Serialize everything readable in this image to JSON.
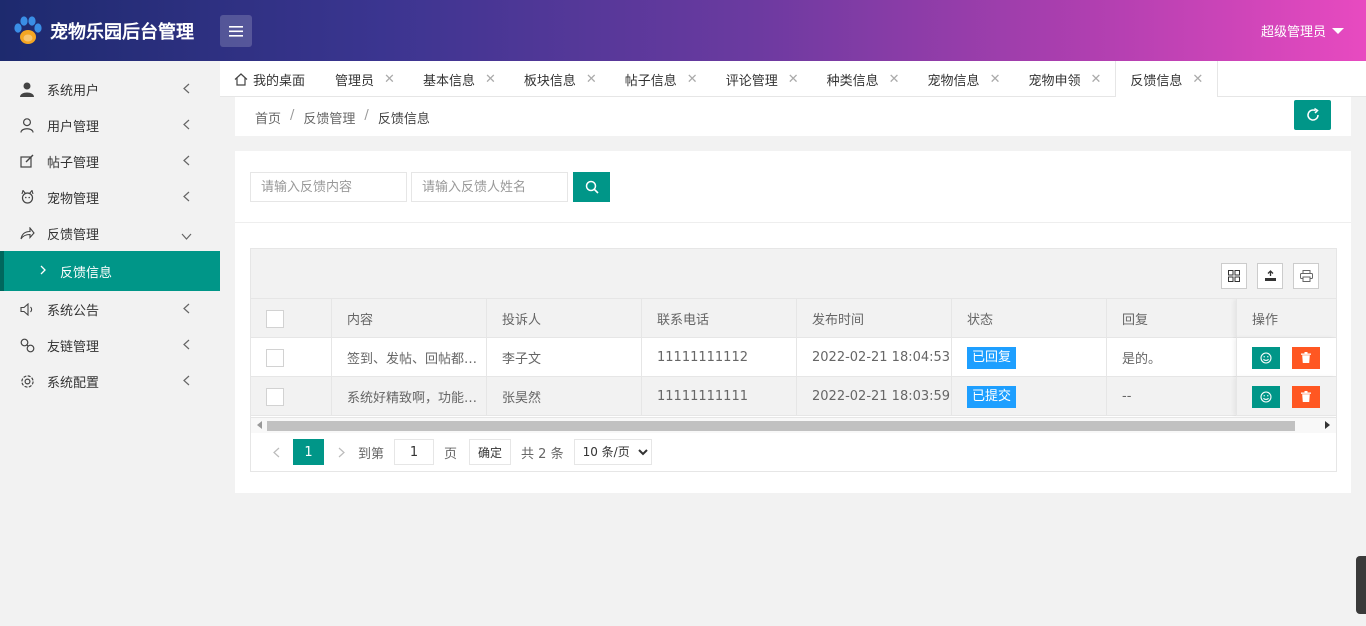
{
  "app": {
    "title": "宠物乐园后台管理",
    "user": "超级管理员"
  },
  "sidebar": {
    "items": [
      {
        "label": "系统用户",
        "icon": "user-solid-icon"
      },
      {
        "label": "用户管理",
        "icon": "user-icon"
      },
      {
        "label": "帖子管理",
        "icon": "edit-icon"
      },
      {
        "label": "宠物管理",
        "icon": "pet-icon"
      },
      {
        "label": "反馈管理",
        "icon": "share-icon",
        "expanded": true
      },
      {
        "label": "系统公告",
        "icon": "speaker-icon"
      },
      {
        "label": "友链管理",
        "icon": "link-icon"
      },
      {
        "label": "系统配置",
        "icon": "gear-icon"
      }
    ],
    "active_sub": "反馈信息"
  },
  "tabs": [
    {
      "label": "我的桌面",
      "closable": false
    },
    {
      "label": "管理员",
      "closable": true
    },
    {
      "label": "基本信息",
      "closable": true
    },
    {
      "label": "板块信息",
      "closable": true
    },
    {
      "label": "帖子信息",
      "closable": true
    },
    {
      "label": "评论管理",
      "closable": true
    },
    {
      "label": "种类信息",
      "closable": true
    },
    {
      "label": "宠物信息",
      "closable": true
    },
    {
      "label": "宠物申领",
      "closable": true
    },
    {
      "label": "反馈信息",
      "closable": true,
      "active": true
    }
  ],
  "breadcrumb": [
    "首页",
    "反馈管理",
    "反馈信息"
  ],
  "search": {
    "content_placeholder": "请输入反馈内容",
    "name_placeholder": "请输入反馈人姓名"
  },
  "table": {
    "columns": [
      "内容",
      "投诉人",
      "联系电话",
      "发布时间",
      "状态",
      "回复",
      "操作"
    ],
    "rows": [
      {
        "content": "签到、发帖、回帖都…",
        "complainant": "李子文",
        "phone": "11111111112",
        "time": "2022-02-21 18:04:53",
        "status": "已回复",
        "reply": "是的。"
      },
      {
        "content": "系统好精致啊，功能…",
        "complainant": "张昊然",
        "phone": "11111111111",
        "time": "2022-02-21 18:03:59",
        "status": "已提交",
        "reply": "--"
      }
    ]
  },
  "pager": {
    "current": "1",
    "goto_label": "到第",
    "goto_value": "1",
    "page_label": "页",
    "confirm": "确定",
    "total": "共 2 条",
    "per_page": "10 条/页"
  },
  "colors": {
    "accent": "#009688",
    "danger": "#ff5722",
    "badge": "#1e9fff"
  }
}
